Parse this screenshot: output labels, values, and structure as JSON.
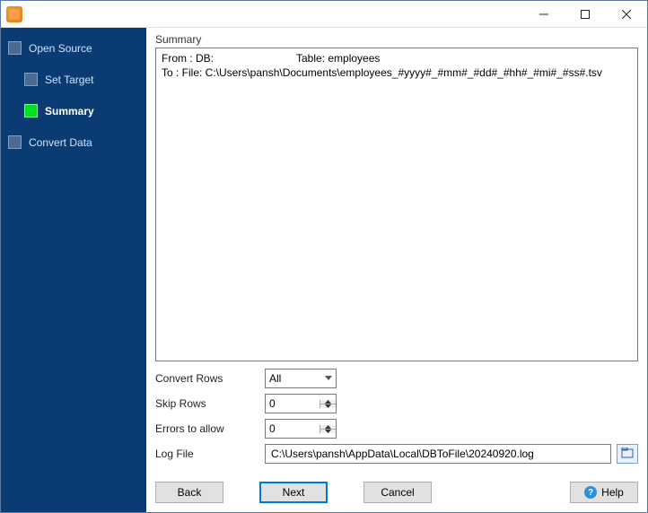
{
  "sidebar": {
    "items": [
      {
        "label": "Open Source"
      },
      {
        "label": "Set Target"
      },
      {
        "label": "Summary"
      },
      {
        "label": "Convert Data"
      }
    ],
    "active_index": 2
  },
  "summary": {
    "group_label": "Summary",
    "line1_prefix": "From : DB:",
    "line1_table_label": "Table:",
    "line1_table_value": "employees",
    "line2": "To : File: C:\\Users\\pansh\\Documents\\employees_#yyyy#_#mm#_#dd#_#hh#_#mi#_#ss#.tsv"
  },
  "form": {
    "convert_rows": {
      "label": "Convert Rows",
      "value": "All"
    },
    "skip_rows": {
      "label": "Skip Rows",
      "value": "0"
    },
    "errors_allow": {
      "label": "Errors to allow",
      "value": "0"
    },
    "log_file": {
      "label": "Log File",
      "value": "C:\\Users\\pansh\\AppData\\Local\\DBToFile\\20240920.log"
    }
  },
  "buttons": {
    "back": "Back",
    "next": "Next",
    "cancel": "Cancel",
    "help": "Help"
  },
  "icons": {
    "help_glyph": "?"
  }
}
